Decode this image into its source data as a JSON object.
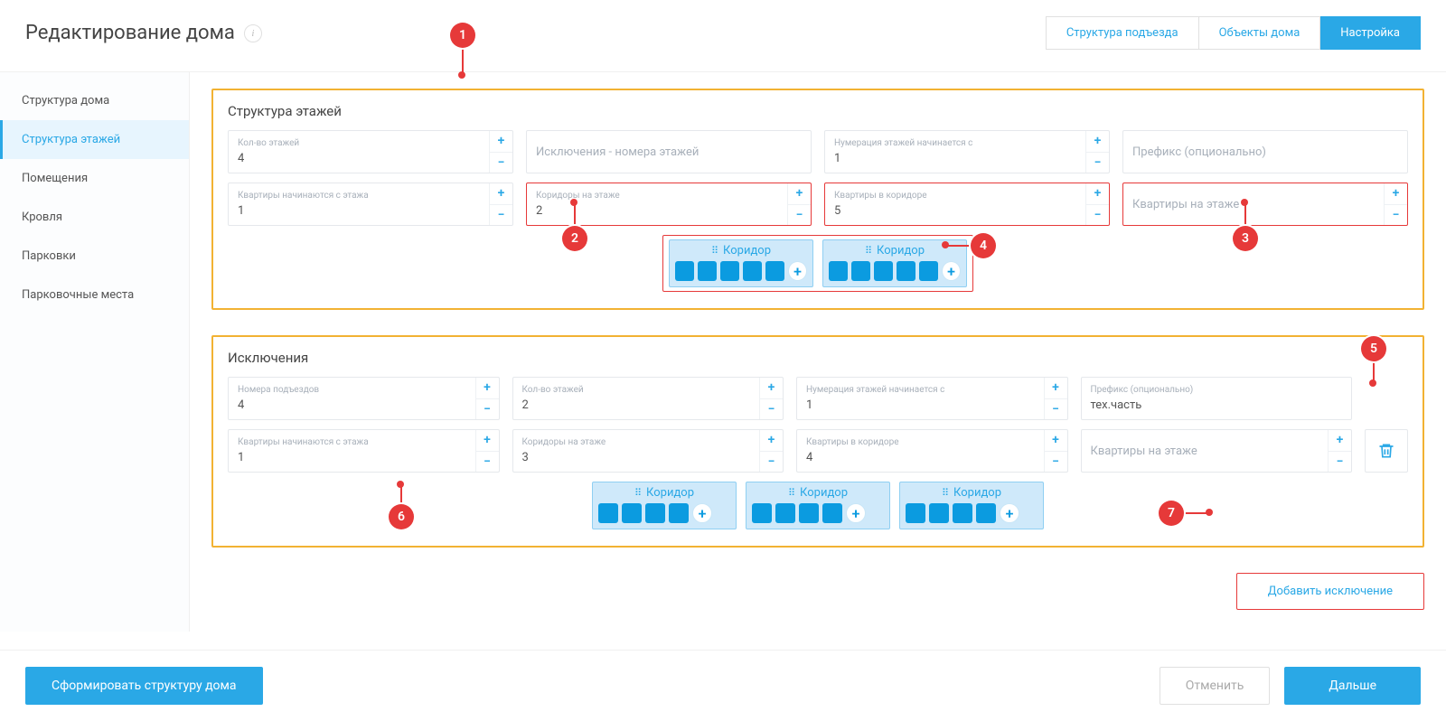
{
  "header": {
    "title": "Редактирование дома",
    "tabs": [
      "Структура подъезда",
      "Объекты дома",
      "Настройка"
    ],
    "active_tab": 2
  },
  "sidebar": {
    "items": [
      "Структура дома",
      "Структура этажей",
      "Помещения",
      "Кровля",
      "Парковки",
      "Парковочные места"
    ],
    "active": 1
  },
  "main_panel": {
    "title": "Структура этажей",
    "row1": {
      "floors": {
        "label": "Кол-во этажей",
        "value": "4"
      },
      "excl": {
        "placeholder": "Исключения - номера этажей"
      },
      "numbering": {
        "label": "Нумерация этажей начинается с",
        "value": "1"
      },
      "prefix": {
        "placeholder": "Префикс (опционально)"
      }
    },
    "row2": {
      "apts_from": {
        "label": "Квартиры начинаются с этажа",
        "value": "1"
      },
      "corridors": {
        "label": "Коридоры на этаже",
        "value": "2"
      },
      "apts_corridor": {
        "label": "Квартиры в коридоре",
        "value": "5"
      },
      "apts_floor": {
        "placeholder": "Квартиры на этаже"
      }
    },
    "corridor_label": "Коридор",
    "corridor_count": 2,
    "rooms_per_corridor": 5
  },
  "exceptions_panel": {
    "title": "Исключения",
    "row1": {
      "entrance_nums": {
        "label": "Номера подъездов",
        "value": "4"
      },
      "floors": {
        "label": "Кол-во этажей",
        "value": "2"
      },
      "numbering": {
        "label": "Нумерация этажей начинается с",
        "value": "1"
      },
      "prefix": {
        "label": "Префикс (опционально)",
        "value": "тех.часть"
      }
    },
    "row2": {
      "apts_from": {
        "label": "Квартиры начинаются с этажа",
        "value": "1"
      },
      "corridors": {
        "label": "Коридоры на этаже",
        "value": "3"
      },
      "apts_corridor": {
        "label": "Квартиры в коридоре",
        "value": "4"
      },
      "apts_floor": {
        "placeholder": "Квартиры на этаже"
      }
    },
    "corridor_label": "Коридор",
    "corridor_count": 3,
    "rooms_per_corridor": 4,
    "add_exception": "Добавить исключение"
  },
  "footer": {
    "generate": "Сформировать структуру дома",
    "cancel": "Отменить",
    "next": "Дальше"
  },
  "callouts": [
    "1",
    "2",
    "3",
    "4",
    "5",
    "6",
    "7"
  ]
}
